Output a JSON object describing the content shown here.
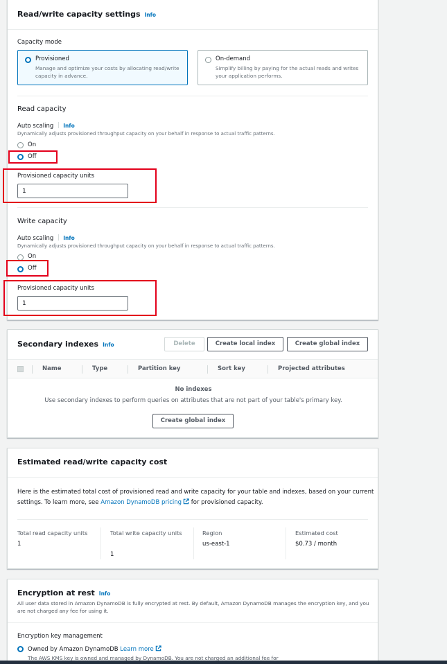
{
  "rw": {
    "title": "Read/write capacity settings",
    "info": "Info",
    "capacity_mode_label": "Capacity mode",
    "provisioned_title": "Provisioned",
    "provisioned_desc_1": "Manage and optimize your costs by allocating read/write",
    "provisioned_desc_2": "capacity in advance.",
    "ondemand_title": "On-demand",
    "ondemand_desc_1": "Simplify billing by paying for the actual reads and writes",
    "ondemand_desc_2": "your application performs.",
    "read_title": "Read capacity",
    "write_title": "Write capacity",
    "auto_scaling": "Auto scaling",
    "auto_scaling_desc": "Dynamically adjusts provisioned throughput capacity on your behalf in response to actual traffic patterns.",
    "on": "On",
    "off": "Off",
    "units_label": "Provisioned capacity units",
    "read_units": "1",
    "write_units": "1"
  },
  "secondary": {
    "title": "Secondary indexes",
    "info": "Info",
    "delete": "Delete",
    "create_local": "Create local index",
    "create_global": "Create global index",
    "columns": [
      "Name",
      "Type",
      "Partition key",
      "Sort key",
      "Projected attributes"
    ],
    "empty_title": "No indexes",
    "empty_desc": "Use secondary indexes to perform queries on attributes that are not part of your table's primary key.",
    "empty_button": "Create global index"
  },
  "cost": {
    "title": "Estimated read/write capacity cost",
    "desc_1": "Here is the estimated total cost of provisioned read and write capacity for your table and indexes, based on your current",
    "desc_2a": "settings. To learn more, see ",
    "desc_link": "Amazon DynamoDB pricing",
    "desc_2b": " for provisioned capacity.",
    "read_label": "Total read capacity units",
    "read_value": "1",
    "write_label": "Total write capacity units",
    "write_value": "1",
    "region_label": "Region",
    "region_value": "us-east-1",
    "est_label": "Estimated cost",
    "est_value": "$0.73 / month"
  },
  "encryption": {
    "title": "Encryption at rest",
    "info": "Info",
    "desc_1": "All user data stored in Amazon DynamoDB is fully encrypted at rest. By default, Amazon DynamoDB manages the encryption key, and you",
    "desc_2": "are not charged any fee for using it.",
    "key_mgmt": "Encryption key management",
    "owned_by": "Owned by Amazon DynamoDB",
    "learn_more": "Learn more",
    "owned_desc": "The AWS KMS key is owned and managed by DynamoDB. You are not charged an additional fee for"
  },
  "colors": {
    "accent": "#0073bb",
    "highlight_red": "#e3001b",
    "border": "#d5dbdb"
  },
  "icons": {
    "external": "external-link-icon"
  }
}
